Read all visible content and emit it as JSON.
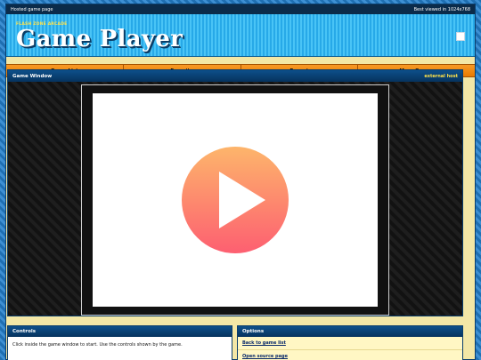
{
  "topbar": {
    "left_text": "Hosted game page",
    "right_text": "Best viewed in 1024x768"
  },
  "banner": {
    "tagline": "FLASH ZONE ARCADE",
    "title": "Game Player",
    "button_icon": "white-square-icon"
  },
  "nav": {
    "items": [
      {
        "label": "Game List"
      },
      {
        "label": "Favorite"
      },
      {
        "label": "Report"
      },
      {
        "label": "More Games"
      }
    ]
  },
  "game_window": {
    "title": "Game Window",
    "external_link": "external host",
    "play_icon": "play-icon",
    "colors": {
      "play_top": "#fdb56b",
      "play_bottom": "#fd5f71"
    }
  },
  "controls": {
    "title": "Controls",
    "text": "Click inside the game window to start. Use the controls shown by the game."
  },
  "options": {
    "title": "Options",
    "links": [
      {
        "label": "Back to game list"
      },
      {
        "label": "Open source page"
      }
    ]
  }
}
